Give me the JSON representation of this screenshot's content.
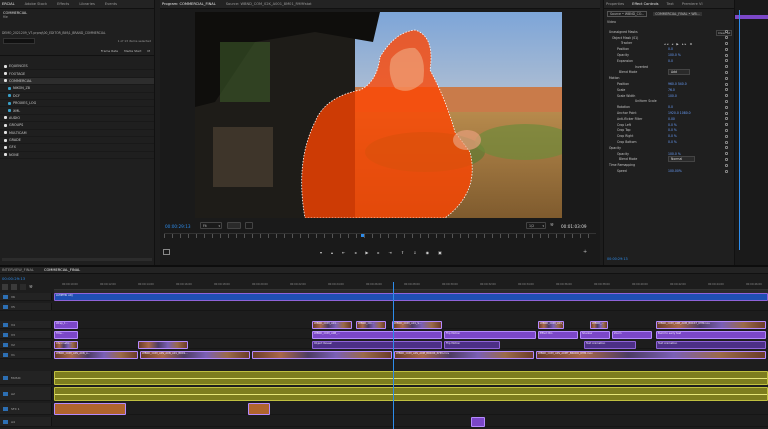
{
  "project": {
    "tabs": [
      "ERCIAL",
      "Adobe Stock",
      "Effects",
      "Libraries",
      "Events"
    ],
    "title": "COMMERCIAL",
    "subtitle": "file",
    "path": "DEMO_2021209_V7.prproj\\00_EDITOR_BIN\\1_BRAND_COMMERCIAL",
    "selection_count": "1 of 13 items selected",
    "columns": [
      "Frame Rate",
      "Media Start",
      "M"
    ],
    "items": [
      {
        "label": "EQUENCES",
        "color": "#e0e0e0"
      },
      {
        "label": "FOOTAGE",
        "color": "#e0e0e0"
      },
      {
        "label": "COMMERCIAL",
        "color": "#e0e0e0"
      },
      {
        "label": "NIKON_Z8",
        "color": "#3aa0c8"
      },
      {
        "label": "DCF",
        "color": "#3aa0c8"
      },
      {
        "label": "PROXIES_LOG",
        "color": "#3aa0c8"
      },
      {
        "label": "XML",
        "color": "#3aa0c8"
      },
      {
        "label": "AUDIO",
        "color": "#e0e0e0"
      },
      {
        "label": "GROUPS",
        "color": "#e0e0e0"
      },
      {
        "label": "MULTICAM",
        "color": "#e0e0e0"
      },
      {
        "label": "GRADE",
        "color": "#e0e0e0"
      },
      {
        "label": "GFX",
        "color": "#e0e0e0"
      },
      {
        "label": "NONE",
        "color": "#e0e0e0"
      }
    ]
  },
  "program": {
    "tab_active": "Program: COMMERCIAL_FINAL",
    "tab_source": "Source: WBND_COM_02K_A001_8M01_R9Mfstat",
    "timecode": "00:00:29:13",
    "fit": "Fit",
    "resolution": "1/2",
    "duration": "00:01:03:09"
  },
  "fx": {
    "tabs": [
      "Properties",
      "Effect Controls",
      "Text",
      "Premiere VI"
    ],
    "source": "Source • WBND_CO...",
    "sequence": "COMMERCIAL_FINAL • WB...",
    "group": "Video",
    "clear_all": "Clear all",
    "rows": [
      {
        "label": "Unassigned Masks",
        "value": "",
        "indent": 2
      },
      {
        "label": "Object Mask (01)",
        "value": "",
        "indent": 5
      },
      {
        "label": "Tracker",
        "value": "",
        "indent": 14
      },
      {
        "label": "Position",
        "value": "0.0",
        "indent": 10
      },
      {
        "label": "Opacity",
        "value": "100.0 %",
        "indent": 10
      },
      {
        "label": "Expansion",
        "value": "0.0",
        "indent": 10
      },
      {
        "label": "Inverted",
        "value": "",
        "indent": 28
      },
      {
        "label": "Blend Mode",
        "value": "Add",
        "indent": 12
      },
      {
        "label": "Motion",
        "value": "",
        "indent": 2
      },
      {
        "label": "Position",
        "value": "960.0   540.0",
        "indent": 10
      },
      {
        "label": "Scale",
        "value": "76.0",
        "indent": 10
      },
      {
        "label": "Scale Width",
        "value": "100.0",
        "indent": 10
      },
      {
        "label": "Uniform Scale",
        "value": "",
        "indent": 28
      },
      {
        "label": "Rotation",
        "value": "0.0",
        "indent": 10
      },
      {
        "label": "Anchor Point",
        "value": "1920.0   1080.0",
        "indent": 10
      },
      {
        "label": "Anti-flicker Filter",
        "value": "0.00",
        "indent": 10
      },
      {
        "label": "Crop Left",
        "value": "0.0 %",
        "indent": 10
      },
      {
        "label": "Crop Top",
        "value": "0.0 %",
        "indent": 10
      },
      {
        "label": "Crop Right",
        "value": "0.0 %",
        "indent": 10
      },
      {
        "label": "Crop Bottom",
        "value": "0.0 %",
        "indent": 10
      },
      {
        "label": "Opacity",
        "value": "",
        "indent": 2
      },
      {
        "label": "Opacity",
        "value": "100.0 %",
        "indent": 10
      },
      {
        "label": "Blend Mode",
        "value": "Normal",
        "indent": 12
      },
      {
        "label": "Time Remapping",
        "value": "",
        "indent": 2
      },
      {
        "label": "Speed",
        "value": "100.00%",
        "indent": 10
      }
    ],
    "timecode": "00:00:29:13"
  },
  "timeline": {
    "tabs": [
      "INTERVIEW_FINAL",
      "COMMERCIAL_FINAL"
    ],
    "timecode": "00:00:29:13",
    "ruler": [
      "00:00:10:00",
      "00:00:12:00",
      "00:00:14:00",
      "00:00:16:00",
      "00:00:18:00",
      "00:00:20:00",
      "00:00:22:00",
      "00:00:24:00",
      "00:00:26:00",
      "00:00:28:00",
      "00:00:30:00",
      "00:00:32:00",
      "00:00:34:00",
      "00:00:36:00",
      "00:00:38:00",
      "00:00:40:00",
      "00:00:42:00",
      "00:00:44:00",
      "00:00:46:00"
    ],
    "tracks": [
      "V6",
      "V5",
      "V4",
      "V3",
      "V2",
      "V1",
      "MUSIC",
      "A2",
      "SFX 1",
      "A4"
    ],
    "clip_labels": {
      "lumetri": "LUMETRI ADJ",
      "v4a": "Wrap_t...",
      "v4b": "WBND_COM_A01...",
      "v4c": "WBND_CO...",
      "v4d": "WBND_COM_A01_S...",
      "v4e": "WBND_COM_A01_...",
      "v4f": "WBND_...",
      "v4g": "WBND_COM_A0B_A0M_BRKST_RHMmov",
      "v3a": "Title...",
      "v3b": "WBND_COM_A0B_...",
      "v3c": "Flip Motion",
      "v3d": "Effect Bin",
      "v3e": "Shadow",
      "v3f": "Zoom",
      "v3g": "Build to early test",
      "v2a": "Chromatic...",
      "v2b": "Object Reveal",
      "v2c": "Flip Motion",
      "v2d": "Text Animation",
      "v2e": "Text Animation",
      "v1a": "WBND_COM_A0S_A0N_A...",
      "v1b": "WBND_COM_A0S_A0N_A01_BRKS...",
      "v1c": "WBND_COM_A0S_A0M_BRKDR_RHM.mov",
      "v1d": "WBND_COM_A0S_A0MT_BRKDR_RHM.mov"
    }
  },
  "colors": {
    "accent": "#2d8ceb",
    "mask": "#ff4400",
    "clip_video": "#7b47c8",
    "clip_audio": "#8a8a22"
  }
}
